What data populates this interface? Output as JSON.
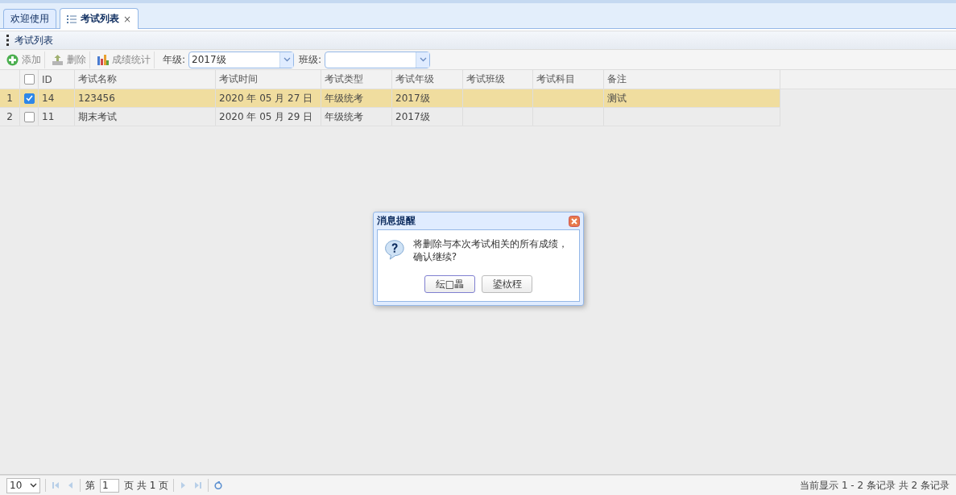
{
  "tabs": [
    {
      "label": "欢迎使用",
      "selected": false
    },
    {
      "label": "考试列表",
      "selected": true,
      "close": "×"
    }
  ],
  "panel_title": "考试列表",
  "toolbar": [
    {
      "kind": "add",
      "label": "添加"
    },
    {
      "kind": "delete",
      "label": "删除"
    },
    {
      "kind": "chart",
      "label": "成绩统计"
    }
  ],
  "filters": [
    {
      "label": "年级:",
      "value": "2017级"
    },
    {
      "label": "班级:"
    }
  ],
  "table": {
    "header_checked": false,
    "columns": [
      "ID",
      "考试名称",
      "考试时间",
      "考试类型",
      "考试年级",
      "考试班级",
      "考试科目",
      "备注"
    ],
    "rows": [
      {
        "number": "1",
        "checked": true,
        "selected": true,
        "cells": [
          "14",
          "123456",
          "2020 年 05 月 27 日",
          "年级统考",
          "2017级",
          null,
          null,
          "测试"
        ]
      },
      {
        "number": "2",
        "checked": false,
        "selected": false,
        "cells": [
          "11",
          "期末考试",
          "2020 年 05 月 29 日",
          "年级统考",
          "2017级",
          null,
          null,
          null
        ]
      }
    ]
  },
  "pager": {
    "page_size": "10",
    "page_prefix": "第",
    "page": "1",
    "page_suffix": "页 共 1 页",
    "status": "当前显示 1 - 2 条记录 共 2 条记录"
  },
  "dialog": {
    "title": "消息提醒",
    "message": "将删除与本次考试相关的所有成绩，确认继续?",
    "buttons": [
      {
        "label": "纭□畾",
        "focused": true
      },
      {
        "label": "鍙栨秷",
        "focused": false
      }
    ]
  }
}
